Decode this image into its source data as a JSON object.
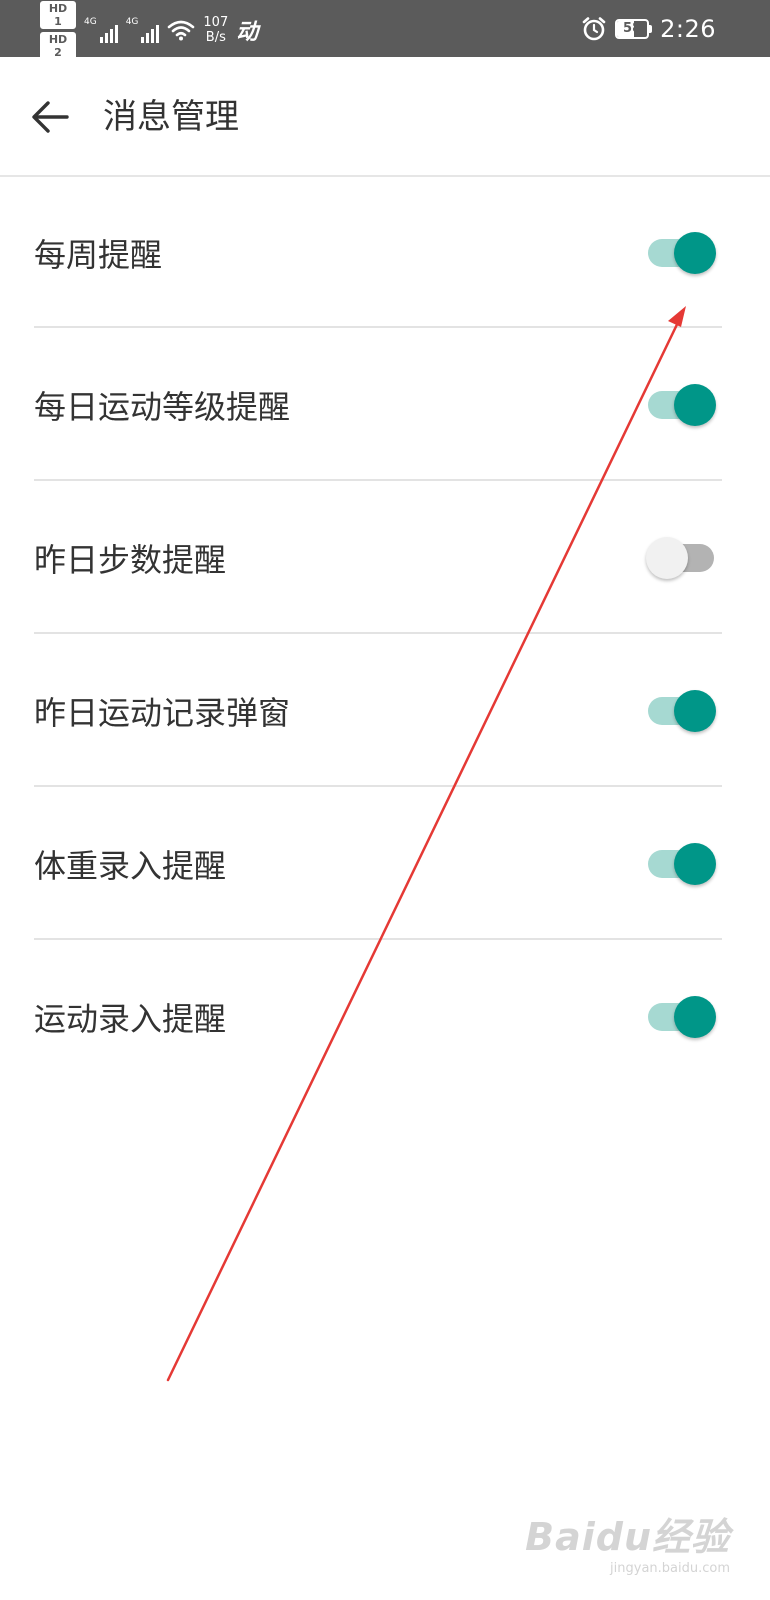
{
  "status_bar": {
    "sim1_badge": "HD 1",
    "sim2_badge": "HD 2",
    "network_1": "4G",
    "network_2": "4G",
    "net_speed_value": "107",
    "net_speed_unit": "B/s",
    "activity_glyph": "动",
    "alarm_icon": "alarm-clock-icon",
    "battery_level": 58,
    "battery_text": "58",
    "time": "2:26"
  },
  "header": {
    "back_icon": "arrow-left-icon",
    "title": "消息管理"
  },
  "settings": [
    {
      "label": "每周提醒",
      "enabled": true
    },
    {
      "label": "每日运动等级提醒",
      "enabled": true
    },
    {
      "label": "昨日步数提醒",
      "enabled": false
    },
    {
      "label": "昨日运动记录弹窗",
      "enabled": true
    },
    {
      "label": "体重录入提醒",
      "enabled": true
    },
    {
      "label": "运动录入提醒",
      "enabled": true
    }
  ],
  "colors": {
    "status_bar_bg": "#5b5b5b",
    "switch_on_thumb": "#009688",
    "switch_on_track": "#a6d9d2",
    "switch_off_thumb": "#f1f1f1",
    "switch_off_track": "#b3b3b3",
    "annotation_arrow": "#e53935"
  },
  "watermark": {
    "logo": "Baidu经验",
    "url": "jingyan.baidu.com"
  }
}
